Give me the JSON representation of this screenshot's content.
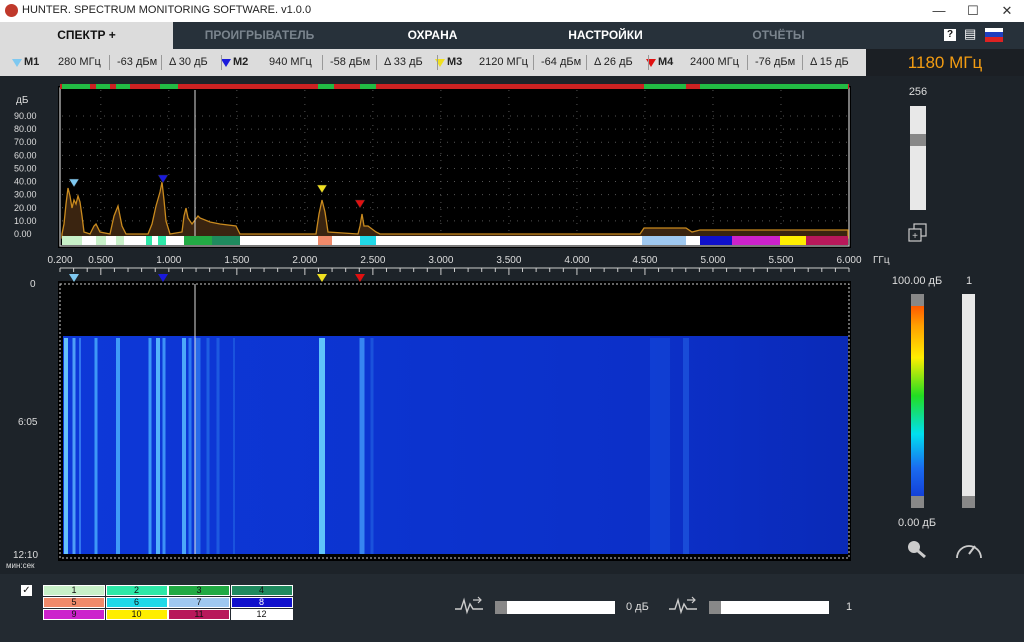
{
  "window": {
    "title": "HUNTER. SPECTRUM MONITORING SOFTWARE. v1.0.0",
    "minimize": "—",
    "maximize": "☐",
    "close": "✕"
  },
  "tabs": [
    {
      "label": "СПЕКТР +",
      "active": true
    },
    {
      "label": "ПРОИГРЫВАТЕЛЬ",
      "active": false
    },
    {
      "label": "ОХРАНА",
      "active": false
    },
    {
      "label": "НАСТРОЙКИ",
      "active": false
    },
    {
      "label": "ОТЧЁТЫ",
      "active": false
    }
  ],
  "header_icons": {
    "help": "?",
    "report": "▤"
  },
  "markers": [
    {
      "name": "M1",
      "freq": "280 МГц",
      "level": "-63 дБм",
      "delta": "Δ 30 дБ",
      "color": "#7ec8f0"
    },
    {
      "name": "M2",
      "freq": "940 МГц",
      "level": "-58 дБм",
      "delta": "Δ 33 дБ",
      "color": "#1a1adb"
    },
    {
      "name": "M3",
      "freq": "2120 МГц",
      "level": "-64 дБм",
      "delta": "Δ 26 дБ",
      "color": "#f0e020"
    },
    {
      "name": "M4",
      "freq": "2400 МГц",
      "level": "-76 дБм",
      "delta": "Δ 15 дБ",
      "color": "#e01010"
    }
  ],
  "center_freq": "1180 МГц",
  "spectrum": {
    "y_unit": "дБ",
    "y_ticks": [
      "90.00",
      "80.00",
      "70.00",
      "60.00",
      "50.00",
      "40.00",
      "30.00",
      "20.00",
      "10.00",
      "0.00"
    ],
    "x_unit": "ГГц",
    "x_ticks": [
      "0.200",
      "0.500",
      "1.000",
      "1.500",
      "2.000",
      "2.500",
      "3.000",
      "3.500",
      "4.000",
      "4.500",
      "5.000",
      "5.500",
      "6.000"
    ],
    "avg_count": "256"
  },
  "waterfall": {
    "time_ticks": [
      "0",
      "6:05",
      "12:10"
    ],
    "time_unit": "мин:сек",
    "scale_max": "100.00 дБ",
    "scale_min": "0.00 дБ",
    "speed_value": "1"
  },
  "bottom": {
    "bands": [
      "1",
      "2",
      "3",
      "4",
      "5",
      "6",
      "7",
      "8",
      "9",
      "10",
      "11",
      "12"
    ],
    "band_colors": [
      "#c8f0c8",
      "#2ee8a8",
      "#22aa44",
      "#1f8a5e",
      "#f08a6a",
      "#20d8e8",
      "#9fc8f0",
      "#1010cc",
      "#cc22cc",
      "#ffee00",
      "#b8185a",
      "#ffffff"
    ],
    "gain_value": "0 дБ",
    "avg_value": "1",
    "check": "✓"
  }
}
